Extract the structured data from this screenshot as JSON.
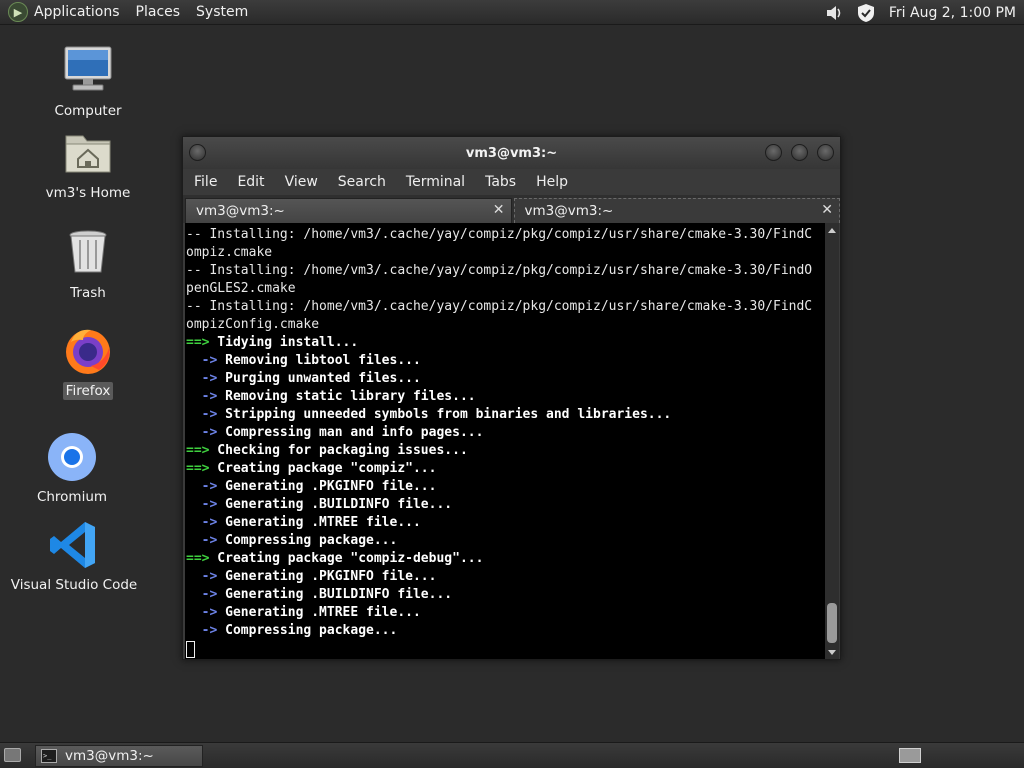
{
  "top_panel": {
    "menus": [
      "Applications",
      "Places",
      "System"
    ],
    "clock": "Fri Aug  2,  1:00 PM",
    "tray_icons": [
      "volume-icon",
      "shield-icon"
    ]
  },
  "desktop": {
    "icons": [
      {
        "label": "Computer",
        "icon": "computer-icon"
      },
      {
        "label": "vm3's Home",
        "icon": "home-folder-icon"
      },
      {
        "label": "Trash",
        "icon": "trash-icon"
      },
      {
        "label": "Firefox",
        "icon": "firefox-icon"
      },
      {
        "label": "Chromium",
        "icon": "chromium-icon"
      },
      {
        "label": "Visual Studio Code",
        "icon": "vscode-icon"
      }
    ]
  },
  "terminal": {
    "title": "vm3@vm3:~",
    "menu": [
      "File",
      "Edit",
      "View",
      "Search",
      "Terminal",
      "Tabs",
      "Help"
    ],
    "tabs": [
      {
        "label": "vm3@vm3:~",
        "active": false
      },
      {
        "label": "vm3@vm3:~",
        "active": true
      }
    ],
    "lines": [
      {
        "prefix": "",
        "text": "-- Installing: /home/vm3/.cache/yay/compiz/pkg/compiz/usr/share/cmake-3.30/FindC",
        "style": "plain"
      },
      {
        "prefix": "",
        "text": "ompiz.cmake",
        "style": "plain"
      },
      {
        "prefix": "",
        "text": "-- Installing: /home/vm3/.cache/yay/compiz/pkg/compiz/usr/share/cmake-3.30/FindO",
        "style": "plain"
      },
      {
        "prefix": "",
        "text": "penGLES2.cmake",
        "style": "plain"
      },
      {
        "prefix": "",
        "text": "-- Installing: /home/vm3/.cache/yay/compiz/pkg/compiz/usr/share/cmake-3.30/FindC",
        "style": "plain"
      },
      {
        "prefix": "",
        "text": "ompizConfig.cmake",
        "style": "plain"
      },
      {
        "prefix": "==>",
        "text": " Tidying install...",
        "style": "green"
      },
      {
        "prefix": "  ->",
        "text": " Removing libtool files...",
        "style": "blue"
      },
      {
        "prefix": "  ->",
        "text": " Purging unwanted files...",
        "style": "blue"
      },
      {
        "prefix": "  ->",
        "text": " Removing static library files...",
        "style": "blue"
      },
      {
        "prefix": "  ->",
        "text": " Stripping unneeded symbols from binaries and libraries...",
        "style": "blue"
      },
      {
        "prefix": "  ->",
        "text": " Compressing man and info pages...",
        "style": "blue"
      },
      {
        "prefix": "==>",
        "text": " Checking for packaging issues...",
        "style": "green"
      },
      {
        "prefix": "==>",
        "text": " Creating package \"compiz\"...",
        "style": "green"
      },
      {
        "prefix": "  ->",
        "text": " Generating .PKGINFO file...",
        "style": "blue"
      },
      {
        "prefix": "  ->",
        "text": " Generating .BUILDINFO file...",
        "style": "blue"
      },
      {
        "prefix": "  ->",
        "text": " Generating .MTREE file...",
        "style": "blue"
      },
      {
        "prefix": "  ->",
        "text": " Compressing package...",
        "style": "blue"
      },
      {
        "prefix": "==>",
        "text": " Creating package \"compiz-debug\"...",
        "style": "green"
      },
      {
        "prefix": "  ->",
        "text": " Generating .PKGINFO file...",
        "style": "blue"
      },
      {
        "prefix": "  ->",
        "text": " Generating .BUILDINFO file...",
        "style": "blue"
      },
      {
        "prefix": "  ->",
        "text": " Generating .MTREE file...",
        "style": "blue"
      },
      {
        "prefix": "  ->",
        "text": " Compressing package...",
        "style": "blue"
      }
    ]
  },
  "taskbar": {
    "window_button": "vm3@vm3:~"
  }
}
